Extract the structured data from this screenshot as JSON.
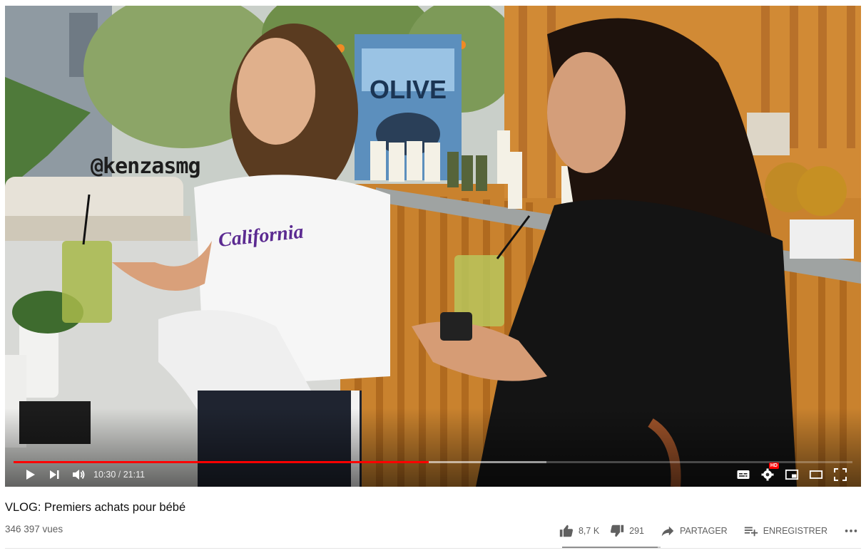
{
  "video": {
    "watermark": "@kenzasmg",
    "progress_played": 0.495,
    "progress_buffered": 0.635,
    "time_current": "10:30",
    "time_separator": "/",
    "time_total": "21:11",
    "colors": {
      "progress_played": "#ff0000",
      "hd_badge": "#ff0000"
    },
    "icons": {
      "play": "play-icon",
      "next": "next-icon",
      "volume": "volume-icon",
      "subtitles": "subtitles-icon",
      "settings": "settings-gear-icon",
      "miniplayer": "miniplayer-icon",
      "theater": "theater-mode-icon",
      "fullscreen": "fullscreen-icon"
    },
    "hd_label": "HD"
  },
  "info": {
    "title": "VLOG: Premiers achats pour bébé",
    "views": "346 397 vues"
  },
  "actions": {
    "like_count": "8,7 K",
    "dislike_count": "291",
    "share_label": "PARTAGER",
    "save_label": "ENREGISTRER",
    "like_ratio": 0.968
  }
}
